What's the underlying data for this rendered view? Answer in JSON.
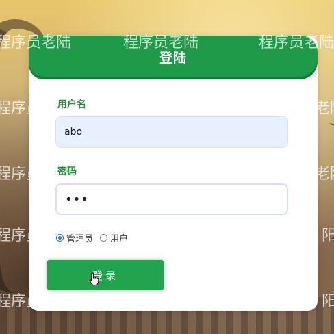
{
  "watermark": {
    "text": "程序员老陆",
    "partials": {
      "pos_b": "老陆",
      "pos_e": "老阳",
      "pos_f": "程序员",
      "pos_i": "阳",
      "pos_j": "程序员",
      "pos_k": "程序员"
    }
  },
  "header": {
    "title": "登陆"
  },
  "form": {
    "username_label": "用户名",
    "username_value": "abo",
    "password_label": "密码",
    "password_value": "•••",
    "roles": [
      {
        "label": "管理员",
        "checked": true
      },
      {
        "label": "用户",
        "checked": false
      }
    ],
    "login_button": "登录"
  },
  "colors": {
    "accent": "#1f9a49",
    "label": "#2b8a3e",
    "radio_checked": "#1a73e8"
  }
}
